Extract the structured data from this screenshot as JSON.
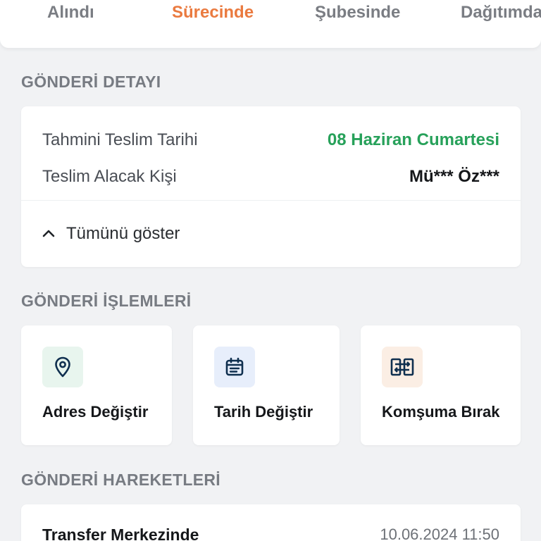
{
  "tabs": [
    {
      "label": "Alındı",
      "active": false
    },
    {
      "label": "Sürecinde",
      "active": true
    },
    {
      "label": "Şubesinde",
      "active": false
    },
    {
      "label": "Dağıtımda",
      "active": false
    }
  ],
  "colors": {
    "active_tab": "#ea7a3f",
    "delivery_date": "#27a15a",
    "background": "#f1f2f4"
  },
  "shipment_detail": {
    "section_title": "GÖNDERİ DETAYI",
    "estimated_label": "Tahmini Teslim Tarihi",
    "estimated_value": "08 Haziran Cumartesi",
    "recipient_label": "Teslim Alacak Kişi",
    "recipient_value": "Mü*** Öz***",
    "expand_label": "Tümünü göster"
  },
  "shipment_actions": {
    "section_title": "GÖNDERİ İŞLEMLERİ",
    "items": [
      {
        "label": "Adres Değiştir",
        "icon": "location-pin-icon",
        "icon_bg": "#e8f5ee"
      },
      {
        "label": "Tarih Değiştir",
        "icon": "calendar-icon",
        "icon_bg": "#e7eefb"
      },
      {
        "label": "Komşuma Bırak",
        "icon": "handover-icon",
        "icon_bg": "#fbeee4"
      }
    ]
  },
  "shipment_movements": {
    "section_title": "GÖNDERİ HAREKETLERİ",
    "items": [
      {
        "title": "Transfer Merkezinde",
        "time": "10.06.2024 11:50"
      }
    ]
  }
}
